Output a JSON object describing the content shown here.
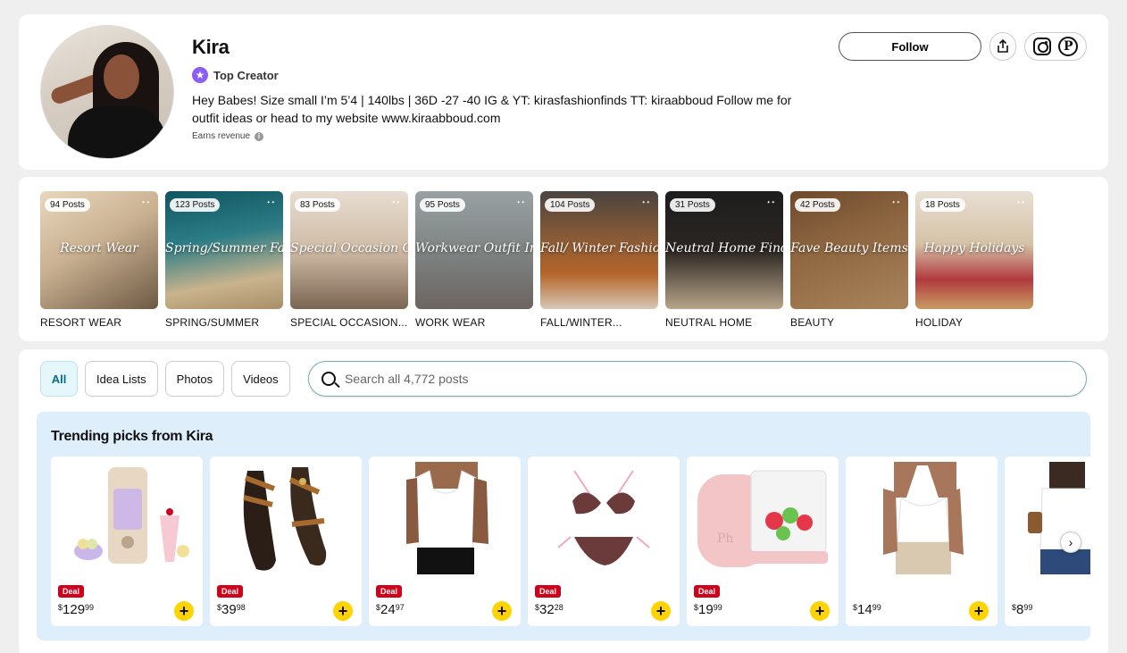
{
  "profile": {
    "name": "Kira",
    "badge": "Top Creator",
    "bio": "Hey Babes! Size small I’m 5’4 | 140lbs | 36D -27 -40 IG & YT: kirasfashionfinds TT: kiraabboud Follow me for outfit ideas or head to my website www.kiraabboud.com",
    "earns": "Earns revenue",
    "follow_label": "Follow"
  },
  "collections": [
    {
      "count": "94 Posts",
      "script": "Resort Wear",
      "label": "RESORT WEAR",
      "bg": "linear-gradient(150deg,#e9d7bd 0%,#c9b091 45%,#6e5a44 100%)"
    },
    {
      "count": "123 Posts",
      "script": "Spring/Summer Fashion",
      "label": "SPRING/SUMMER",
      "bg": "linear-gradient(170deg,#0f5560 0%,#2d7d86 40%,#c9b38c 75%,#a88f69 100%)"
    },
    {
      "count": "83 Posts",
      "script": "Special Occasion Outfits",
      "label": "SPECIAL OCCASION...",
      "bg": "linear-gradient(180deg,#e7ddd1 0%,#cfbba6 50%,#7b6553 100%)"
    },
    {
      "count": "95 Posts",
      "script": "Workwear Outfit Inspo",
      "label": "WORK WEAR",
      "bg": "linear-gradient(180deg,#9aa1a3 0%,#7f8584 50%,#6c6461 100%)"
    },
    {
      "count": "104 Posts",
      "script": "Fall/ Winter Fashion",
      "label": "FALL/WINTER...",
      "bg": "linear-gradient(180deg,#4a4440 0%,#8a5a36 40%,#b5652a 70%,#d7c8b6 100%)"
    },
    {
      "count": "31 Posts",
      "script": "Neutral Home Finds",
      "label": "NEUTRAL HOME",
      "bg": "linear-gradient(180deg,#1d1d1d 0%,#2b2622 50%,#b8a58a 100%)"
    },
    {
      "count": "42 Posts",
      "script": "Fave Beauty Items",
      "label": "BEAUTY",
      "bg": "linear-gradient(160deg,#6d4a2d 0%,#8d6540 40%,#a9845b 100%)"
    },
    {
      "count": "18 Posts",
      "script": "Happy Holidays",
      "label": "HOLIDAY",
      "bg": "linear-gradient(180deg,#e8dfd4 0%,#d5c2a6 45%,#b23a3f 75%,#c89c63 100%)"
    }
  ],
  "filters": [
    "All",
    "Idea Lists",
    "Photos",
    "Videos"
  ],
  "search": {
    "placeholder": "Search all 4,772 posts"
  },
  "trending": {
    "title": "Trending picks from Kira",
    "deal_label": "Deal",
    "products": [
      {
        "deal": true,
        "currency": "$",
        "dollars": "129",
        "cents": "99",
        "kind": "blender"
      },
      {
        "deal": true,
        "currency": "$",
        "dollars": "39",
        "cents": "98",
        "kind": "sandal"
      },
      {
        "deal": true,
        "currency": "$",
        "dollars": "24",
        "cents": "97",
        "kind": "tank"
      },
      {
        "deal": true,
        "currency": "$",
        "dollars": "32",
        "cents": "28",
        "kind": "bikini"
      },
      {
        "deal": true,
        "currency": "$",
        "dollars": "19",
        "cents": "99",
        "kind": "chopper"
      },
      {
        "deal": false,
        "currency": "$",
        "dollars": "14",
        "cents": "99",
        "kind": "halter"
      },
      {
        "deal": false,
        "currency": "$",
        "dollars": "8",
        "cents": "99",
        "kind": "sleeveless"
      }
    ]
  }
}
